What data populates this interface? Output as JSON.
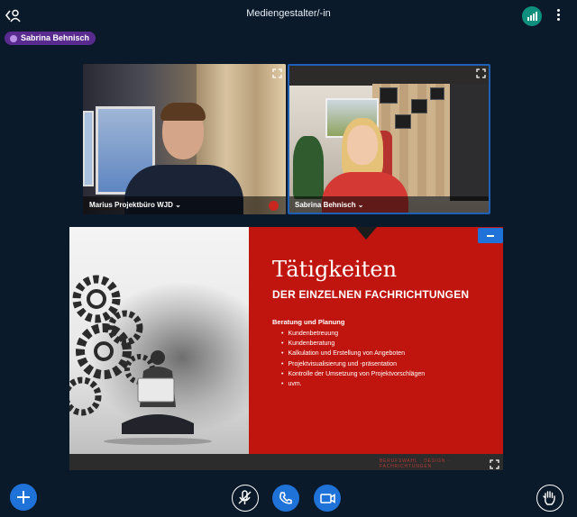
{
  "header": {
    "title": "Mediengestalter/-in",
    "back_icon": "user-back-icon",
    "connection_icon": "signal-bars-icon",
    "menu_icon": "kebab-menu-icon",
    "accent_color": "#0f8f7e"
  },
  "talking_indicator": {
    "name": "Sabrina Behnisch",
    "color": "#5a2b8f"
  },
  "videos": [
    {
      "name": "Marius Projektbüro WJD",
      "muted": true
    },
    {
      "name": "Sabrina Behnisch",
      "active_speaker": true,
      "highlight_color": "#1f5fb4"
    }
  ],
  "presentation": {
    "title": "Tätigkeiten",
    "subtitle": "DER EINZELNEN FACHRICHTUNGEN",
    "section_heading": "Beratung und Planung",
    "items": [
      "Kundenbetreuung",
      "Kundenberatung",
      "Kalkulation und Erstellung von Angeboten",
      "Projektvisualisierung und -präsentation",
      "Kontrolle der Umsetzung von Projektvorschlägen",
      "uvm."
    ],
    "footer": "BERUFSWAHL · DESIGN · FACHRICHTUNGEN",
    "brand_color": "#c0150f"
  },
  "controls": {
    "actions_icon": "plus-icon",
    "mic_icon": "mic-muted-icon",
    "audio_icon": "phone-icon",
    "video_icon": "camera-icon",
    "raise_hand_icon": "hand-icon",
    "button_color": "#1f72d8"
  }
}
